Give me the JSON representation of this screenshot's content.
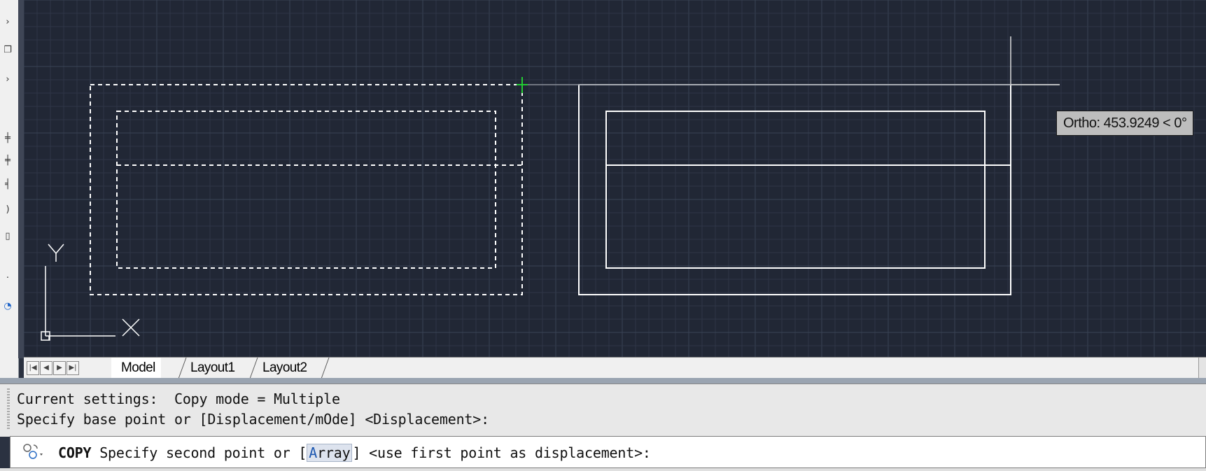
{
  "canvas": {
    "background": "#212735",
    "grid_color": "#2e3646",
    "grid_major_color": "#394355",
    "object_color": "#ffffff",
    "cursor_color": "#22cc33",
    "ucs": {
      "y_label": "Y",
      "x_label": "X"
    },
    "tooltip": "Ortho: 453.9249 < 0°"
  },
  "left_toolbar": {
    "icons": [
      "flip-icon",
      "copy-icon",
      "mirror-icon",
      "offset-icon",
      "stretch-icon",
      "scale-icon",
      "trim-icon",
      "table-icon",
      "dot-icon",
      "blue-circle-icon"
    ]
  },
  "layout_tabs": {
    "nav": [
      "first-tab-icon",
      "prev-tab-icon",
      "next-tab-icon",
      "last-tab-icon"
    ],
    "tabs": [
      {
        "label": "Model",
        "active": true
      },
      {
        "label": "Layout1",
        "active": false
      },
      {
        "label": "Layout2",
        "active": false
      }
    ]
  },
  "command_history": [
    "Current settings:  Copy mode = Multiple",
    "Specify base point or [Displacement/mOde] <Displacement>:"
  ],
  "command_input": {
    "command": "COPY",
    "prompt_before": " Specify second point or [",
    "option_hot": "A",
    "option_rest": "rray",
    "prompt_after": "] <use first point as displacement>:"
  }
}
